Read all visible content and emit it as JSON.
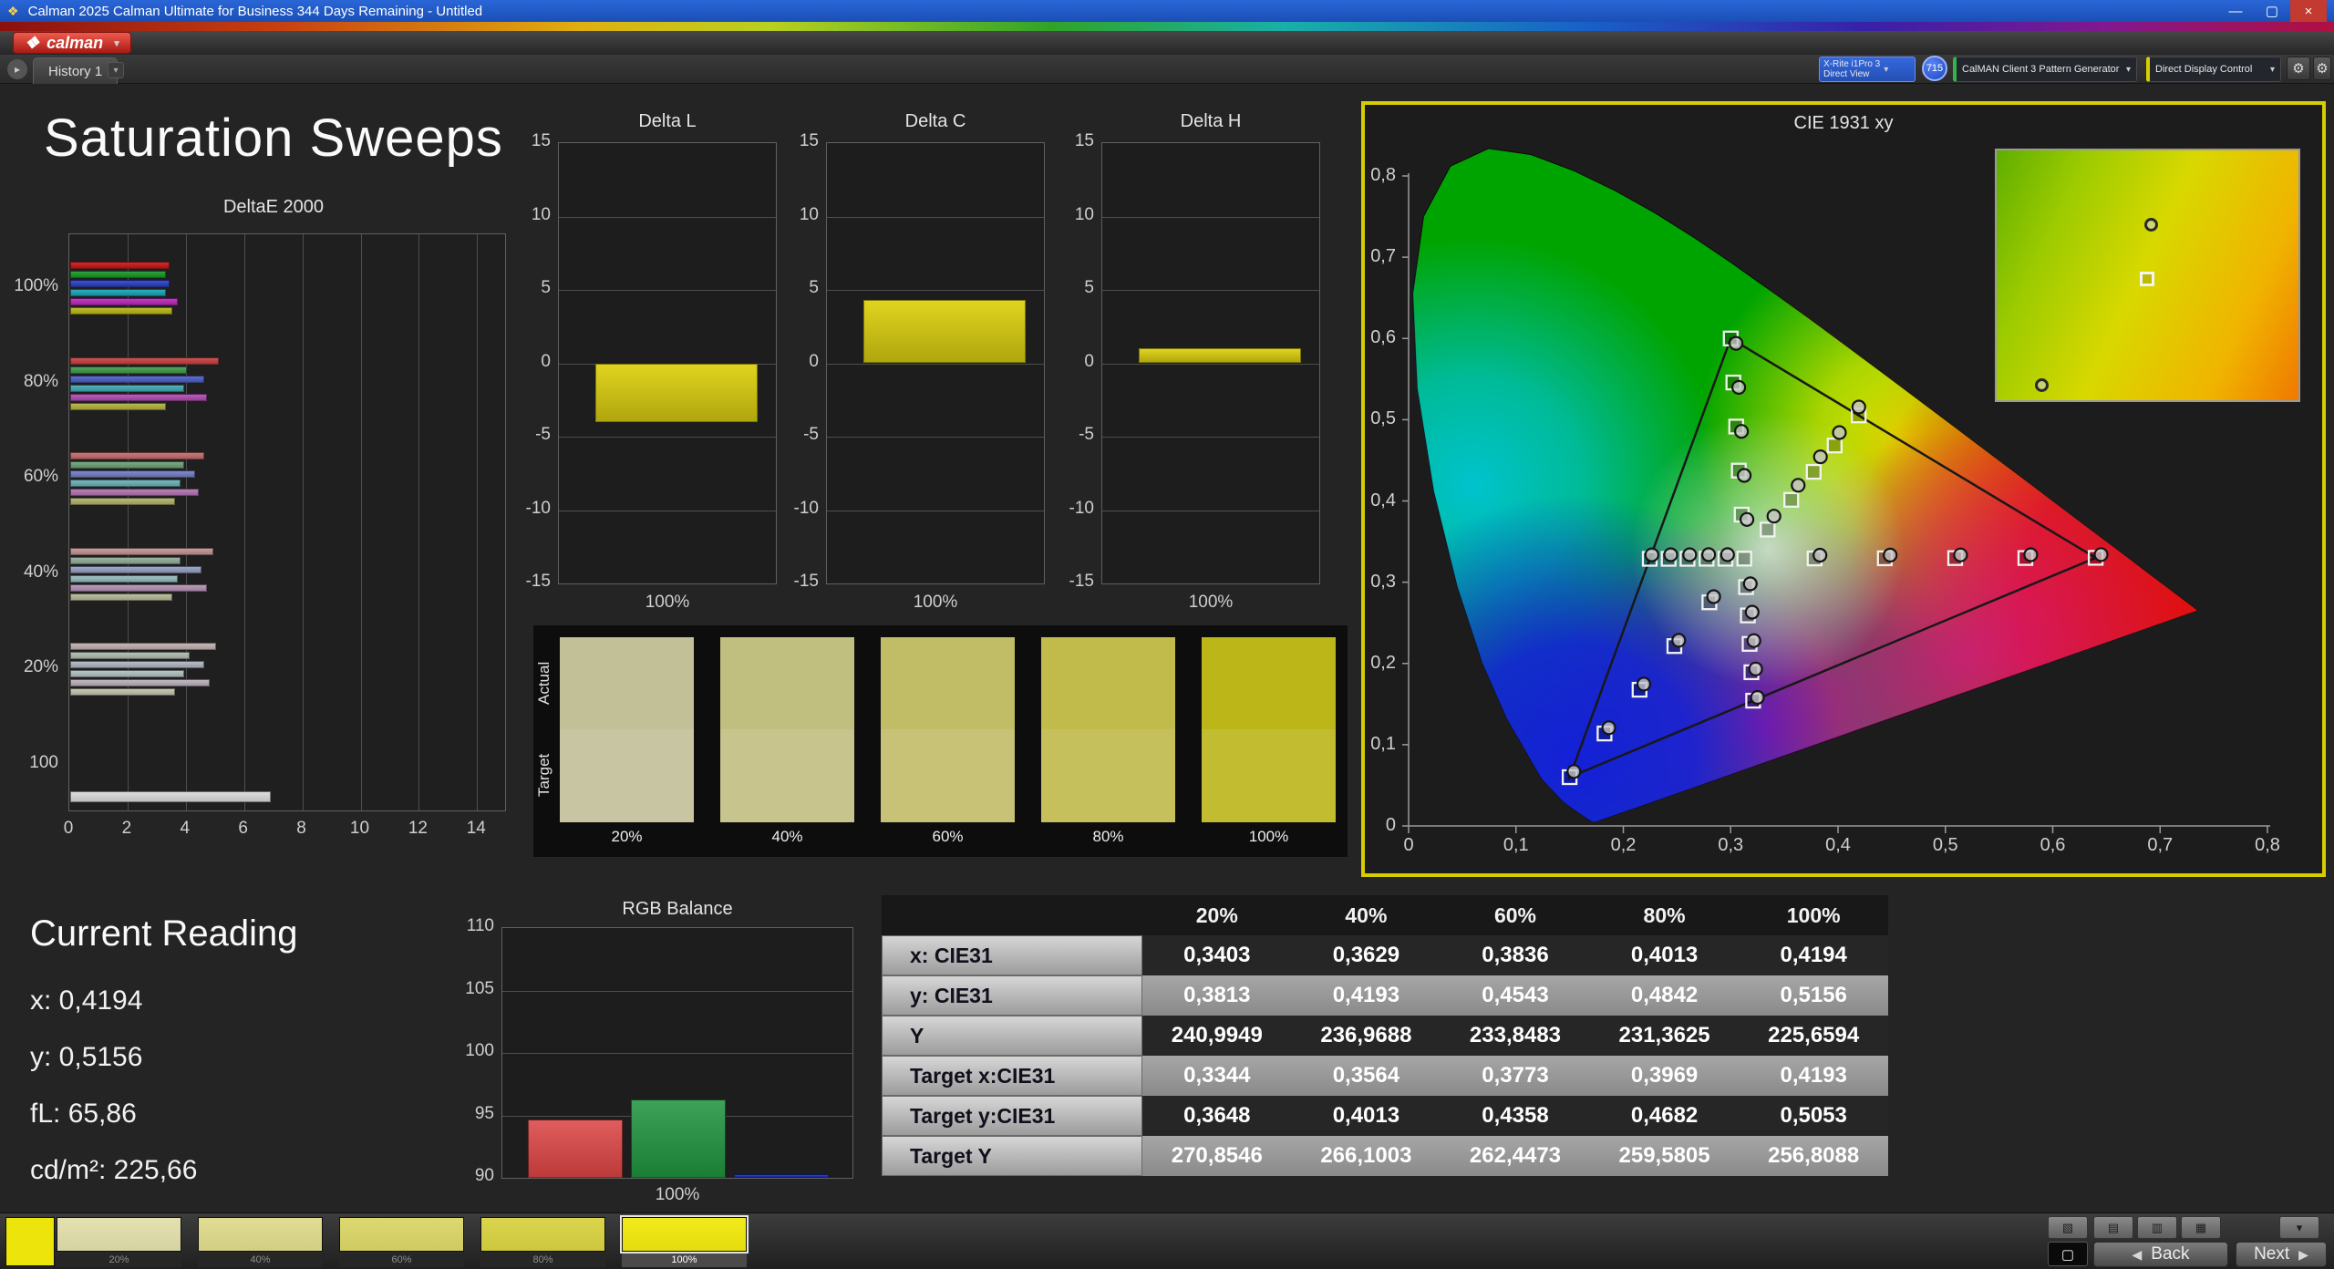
{
  "window": {
    "title": "Calman 2025 Calman Ultimate for Business 344 Days Remaining  - Untitled"
  },
  "icons": {
    "app": "❖",
    "logo_mark": "❖",
    "dropdown": "▾",
    "tab_arrow": "▸",
    "minimize": "—",
    "maximize": "▢",
    "close": "×",
    "gear": "⚙",
    "back_arrow": "◀",
    "next_arrow": "▶",
    "pattern_window": "▢",
    "tool_1": "▤",
    "tool_2": "▥",
    "tool_3": "▦",
    "tool_4": "▧",
    "tool_dropdown": "▾"
  },
  "brand": {
    "logo_text": "calman"
  },
  "tabs": {
    "active": "History 1"
  },
  "devices": {
    "meter_line1": "X-Rite i1Pro 3",
    "meter_line2": "Direct View",
    "meter_badge": "715",
    "pattern_source": "CalMAN Client 3 Pattern Generator",
    "display_control": "Direct Display Control"
  },
  "page": {
    "title": "Saturation Sweeps"
  },
  "current_reading": {
    "title": "Current Reading",
    "lines": [
      "x: 0,4194",
      "y: 0,5156",
      "fL: 65,86",
      "cd/m²: 225,66"
    ]
  },
  "swatch_panel": {
    "row_labels": [
      "Actual",
      "Target"
    ],
    "columns": [
      {
        "label": "20%",
        "actual": "#c1c096",
        "target": "#c8c6a2"
      },
      {
        "label": "40%",
        "actual": "#c1bf7f",
        "target": "#c7c48d"
      },
      {
        "label": "60%",
        "actual": "#c1bd66",
        "target": "#c7c276"
      },
      {
        "label": "80%",
        "actual": "#c0bb4b",
        "target": "#c5c05c"
      },
      {
        "label": "100%",
        "actual": "#bdb618",
        "target": "#c2bc30"
      }
    ]
  },
  "table": {
    "columns": [
      "20%",
      "40%",
      "60%",
      "80%",
      "100%"
    ],
    "rows": [
      {
        "label": "x: CIE31",
        "values": [
          "0,3403",
          "0,3629",
          "0,3836",
          "0,4013",
          "0,4194"
        ]
      },
      {
        "label": "y: CIE31",
        "values": [
          "0,3813",
          "0,4193",
          "0,4543",
          "0,4842",
          "0,5156"
        ]
      },
      {
        "label": "Y",
        "values": [
          "240,9949",
          "236,9688",
          "233,8483",
          "231,3625",
          "225,6594"
        ]
      },
      {
        "label": "Target x:CIE31",
        "values": [
          "0,3344",
          "0,3564",
          "0,3773",
          "0,3969",
          "0,4193"
        ]
      },
      {
        "label": "Target y:CIE31",
        "values": [
          "0,3648",
          "0,4013",
          "0,4358",
          "0,4682",
          "0,5053"
        ]
      },
      {
        "label": "Target Y",
        "values": [
          "270,8546",
          "266,1003",
          "262,4473",
          "259,5805",
          "256,8088"
        ]
      }
    ]
  },
  "footer": {
    "current_color": "#ece40a",
    "swatches": [
      {
        "label": "20%",
        "color": "#d6d3a2",
        "selected": false
      },
      {
        "label": "40%",
        "color": "#d2cf84",
        "selected": false
      },
      {
        "label": "60%",
        "color": "#cfcb62",
        "selected": false
      },
      {
        "label": "80%",
        "color": "#ccc73e",
        "selected": false
      },
      {
        "label": "100%",
        "color": "#e4dc0c",
        "selected": true
      }
    ],
    "back": "Back",
    "next": "Next"
  },
  "chart_data": [
    {
      "id": "deltae2000",
      "type": "bar",
      "orientation": "horizontal",
      "title": "DeltaE 2000",
      "xlim": [
        0,
        15
      ],
      "x_ticks": [
        0,
        2,
        4,
        6,
        8,
        10,
        12,
        14
      ],
      "groups": [
        {
          "label": "100%",
          "values": [
            3.4,
            3.3,
            3.4,
            3.3,
            3.7,
            3.5
          ],
          "colors": [
            "#cc2f2f",
            "#2fa33c",
            "#3f54cc",
            "#2fadbc",
            "#bf3fbf",
            "#bcbc2e"
          ]
        },
        {
          "label": "80%",
          "values": [
            5.1,
            4.0,
            4.6,
            3.9,
            4.7,
            3.3
          ],
          "colors": [
            "#cc5454",
            "#54a65e",
            "#5f70cc",
            "#54b1bc",
            "#b95fb9",
            "#b9b954"
          ]
        },
        {
          "label": "60%",
          "values": [
            4.6,
            3.9,
            4.3,
            3.8,
            4.4,
            3.6
          ],
          "colors": [
            "#c97a7a",
            "#7aab82",
            "#828bc9",
            "#7ab8bc",
            "#b982b9",
            "#b9b97a"
          ]
        },
        {
          "label": "40%",
          "values": [
            4.9,
            3.8,
            4.5,
            3.7,
            4.7,
            3.5
          ],
          "colors": [
            "#c79e9e",
            "#9eb4a2",
            "#a0a8c7",
            "#9ec2c2",
            "#bc9ebc",
            "#bebea0"
          ]
        },
        {
          "label": "20%",
          "values": [
            5.0,
            4.1,
            4.6,
            3.9,
            4.8,
            3.6
          ],
          "colors": [
            "#c7b8b8",
            "#b6c2b8",
            "#b8bcc7",
            "#b8c6c6",
            "#c2b8c2",
            "#c8c8b6"
          ]
        },
        {
          "label": "100",
          "values": [
            6.9
          ],
          "colors": [
            "#dcdcdc"
          ]
        }
      ]
    },
    {
      "id": "delta_l",
      "type": "bar",
      "title": "Delta L",
      "categories": [
        "100%"
      ],
      "values": [
        -4.0
      ],
      "ylim": [
        -15,
        15
      ],
      "y_ticks": [
        15,
        10,
        5,
        0,
        -5,
        -10,
        -15
      ]
    },
    {
      "id": "delta_c",
      "type": "bar",
      "title": "Delta C",
      "categories": [
        "100%"
      ],
      "values": [
        4.3
      ],
      "ylim": [
        -15,
        15
      ],
      "y_ticks": [
        15,
        10,
        5,
        0,
        -5,
        -10,
        -15
      ]
    },
    {
      "id": "delta_h",
      "type": "bar",
      "title": "Delta H",
      "categories": [
        "100%"
      ],
      "values": [
        1.0
      ],
      "ylim": [
        -15,
        15
      ],
      "y_ticks": [
        15,
        10,
        5,
        0,
        -5,
        -10,
        -15
      ]
    },
    {
      "id": "rgb_balance",
      "type": "bar",
      "title": "RGB Balance",
      "categories": [
        "100%"
      ],
      "ylim": [
        90,
        110
      ],
      "y_ticks": [
        110,
        105,
        100,
        95,
        90
      ],
      "series": [
        {
          "name": "Red",
          "color": "#e05d5d",
          "value": 94.7
        },
        {
          "name": "Green",
          "color": "#3da257",
          "value": 96.3
        },
        {
          "name": "Blue",
          "color": "#3346c8",
          "value": 90.3
        }
      ]
    },
    {
      "id": "cie1931",
      "type": "scatter",
      "title": "CIE 1931 xy",
      "xlim": [
        0,
        0.8
      ],
      "ylim": [
        0,
        0.8
      ],
      "x_ticks": [
        "0",
        "0,1",
        "0,2",
        "0,3",
        "0,4",
        "0,5",
        "0,6",
        "0,7",
        "0,8"
      ],
      "y_ticks": [
        "0",
        "0,1",
        "0,2",
        "0,3",
        "0,4",
        "0,5",
        "0,6",
        "0,7",
        "0,8"
      ],
      "gamut_triangle": [
        [
          0.64,
          0.33
        ],
        [
          0.3,
          0.6
        ],
        [
          0.15,
          0.06
        ]
      ],
      "white_point": [
        0.3127,
        0.329
      ],
      "target_points": [
        [
          0.3782,
          0.3292
        ],
        [
          0.4436,
          0.3294
        ],
        [
          0.5091,
          0.3296
        ],
        [
          0.5745,
          0.3298
        ],
        [
          0.64,
          0.33
        ],
        [
          0.3102,
          0.3832
        ],
        [
          0.3076,
          0.4374
        ],
        [
          0.3051,
          0.4916
        ],
        [
          0.3025,
          0.5458
        ],
        [
          0.3,
          0.6
        ],
        [
          0.2802,
          0.2752
        ],
        [
          0.2476,
          0.2214
        ],
        [
          0.2151,
          0.1676
        ],
        [
          0.1825,
          0.1138
        ],
        [
          0.15,
          0.06
        ],
        [
          0.2951,
          0.3289
        ],
        [
          0.2775,
          0.3289
        ],
        [
          0.2598,
          0.3288
        ],
        [
          0.2422,
          0.3288
        ],
        [
          0.2246,
          0.3287
        ],
        [
          0.3143,
          0.294
        ],
        [
          0.316,
          0.2591
        ],
        [
          0.3176,
          0.2241
        ],
        [
          0.3193,
          0.1892
        ],
        [
          0.3209,
          0.1542
        ],
        [
          0.3344,
          0.3648
        ],
        [
          0.3564,
          0.4013
        ],
        [
          0.3773,
          0.4358
        ],
        [
          0.3969,
          0.4682
        ],
        [
          0.4193,
          0.5053
        ]
      ],
      "measured_points": [
        [
          0.3832,
          0.3332
        ],
        [
          0.4486,
          0.3334
        ],
        [
          0.5141,
          0.3336
        ],
        [
          0.5795,
          0.3338
        ],
        [
          0.645,
          0.334
        ],
        [
          0.3152,
          0.3772
        ],
        [
          0.3126,
          0.4314
        ],
        [
          0.3101,
          0.4856
        ],
        [
          0.3075,
          0.5398
        ],
        [
          0.305,
          0.594
        ],
        [
          0.2842,
          0.2822
        ],
        [
          0.2516,
          0.2284
        ],
        [
          0.2191,
          0.1746
        ],
        [
          0.1865,
          0.1208
        ],
        [
          0.154,
          0.067
        ],
        [
          0.2971,
          0.3339
        ],
        [
          0.2795,
          0.3339
        ],
        [
          0.2618,
          0.3338
        ],
        [
          0.2442,
          0.3338
        ],
        [
          0.2266,
          0.3337
        ],
        [
          0.3183,
          0.298
        ],
        [
          0.32,
          0.2631
        ],
        [
          0.3216,
          0.2281
        ],
        [
          0.3233,
          0.1932
        ],
        [
          0.3249,
          0.1582
        ],
        [
          0.3403,
          0.3813
        ],
        [
          0.3629,
          0.4193
        ],
        [
          0.3836,
          0.4543
        ],
        [
          0.4013,
          0.4842
        ],
        [
          0.4194,
          0.5156
        ]
      ]
    }
  ]
}
